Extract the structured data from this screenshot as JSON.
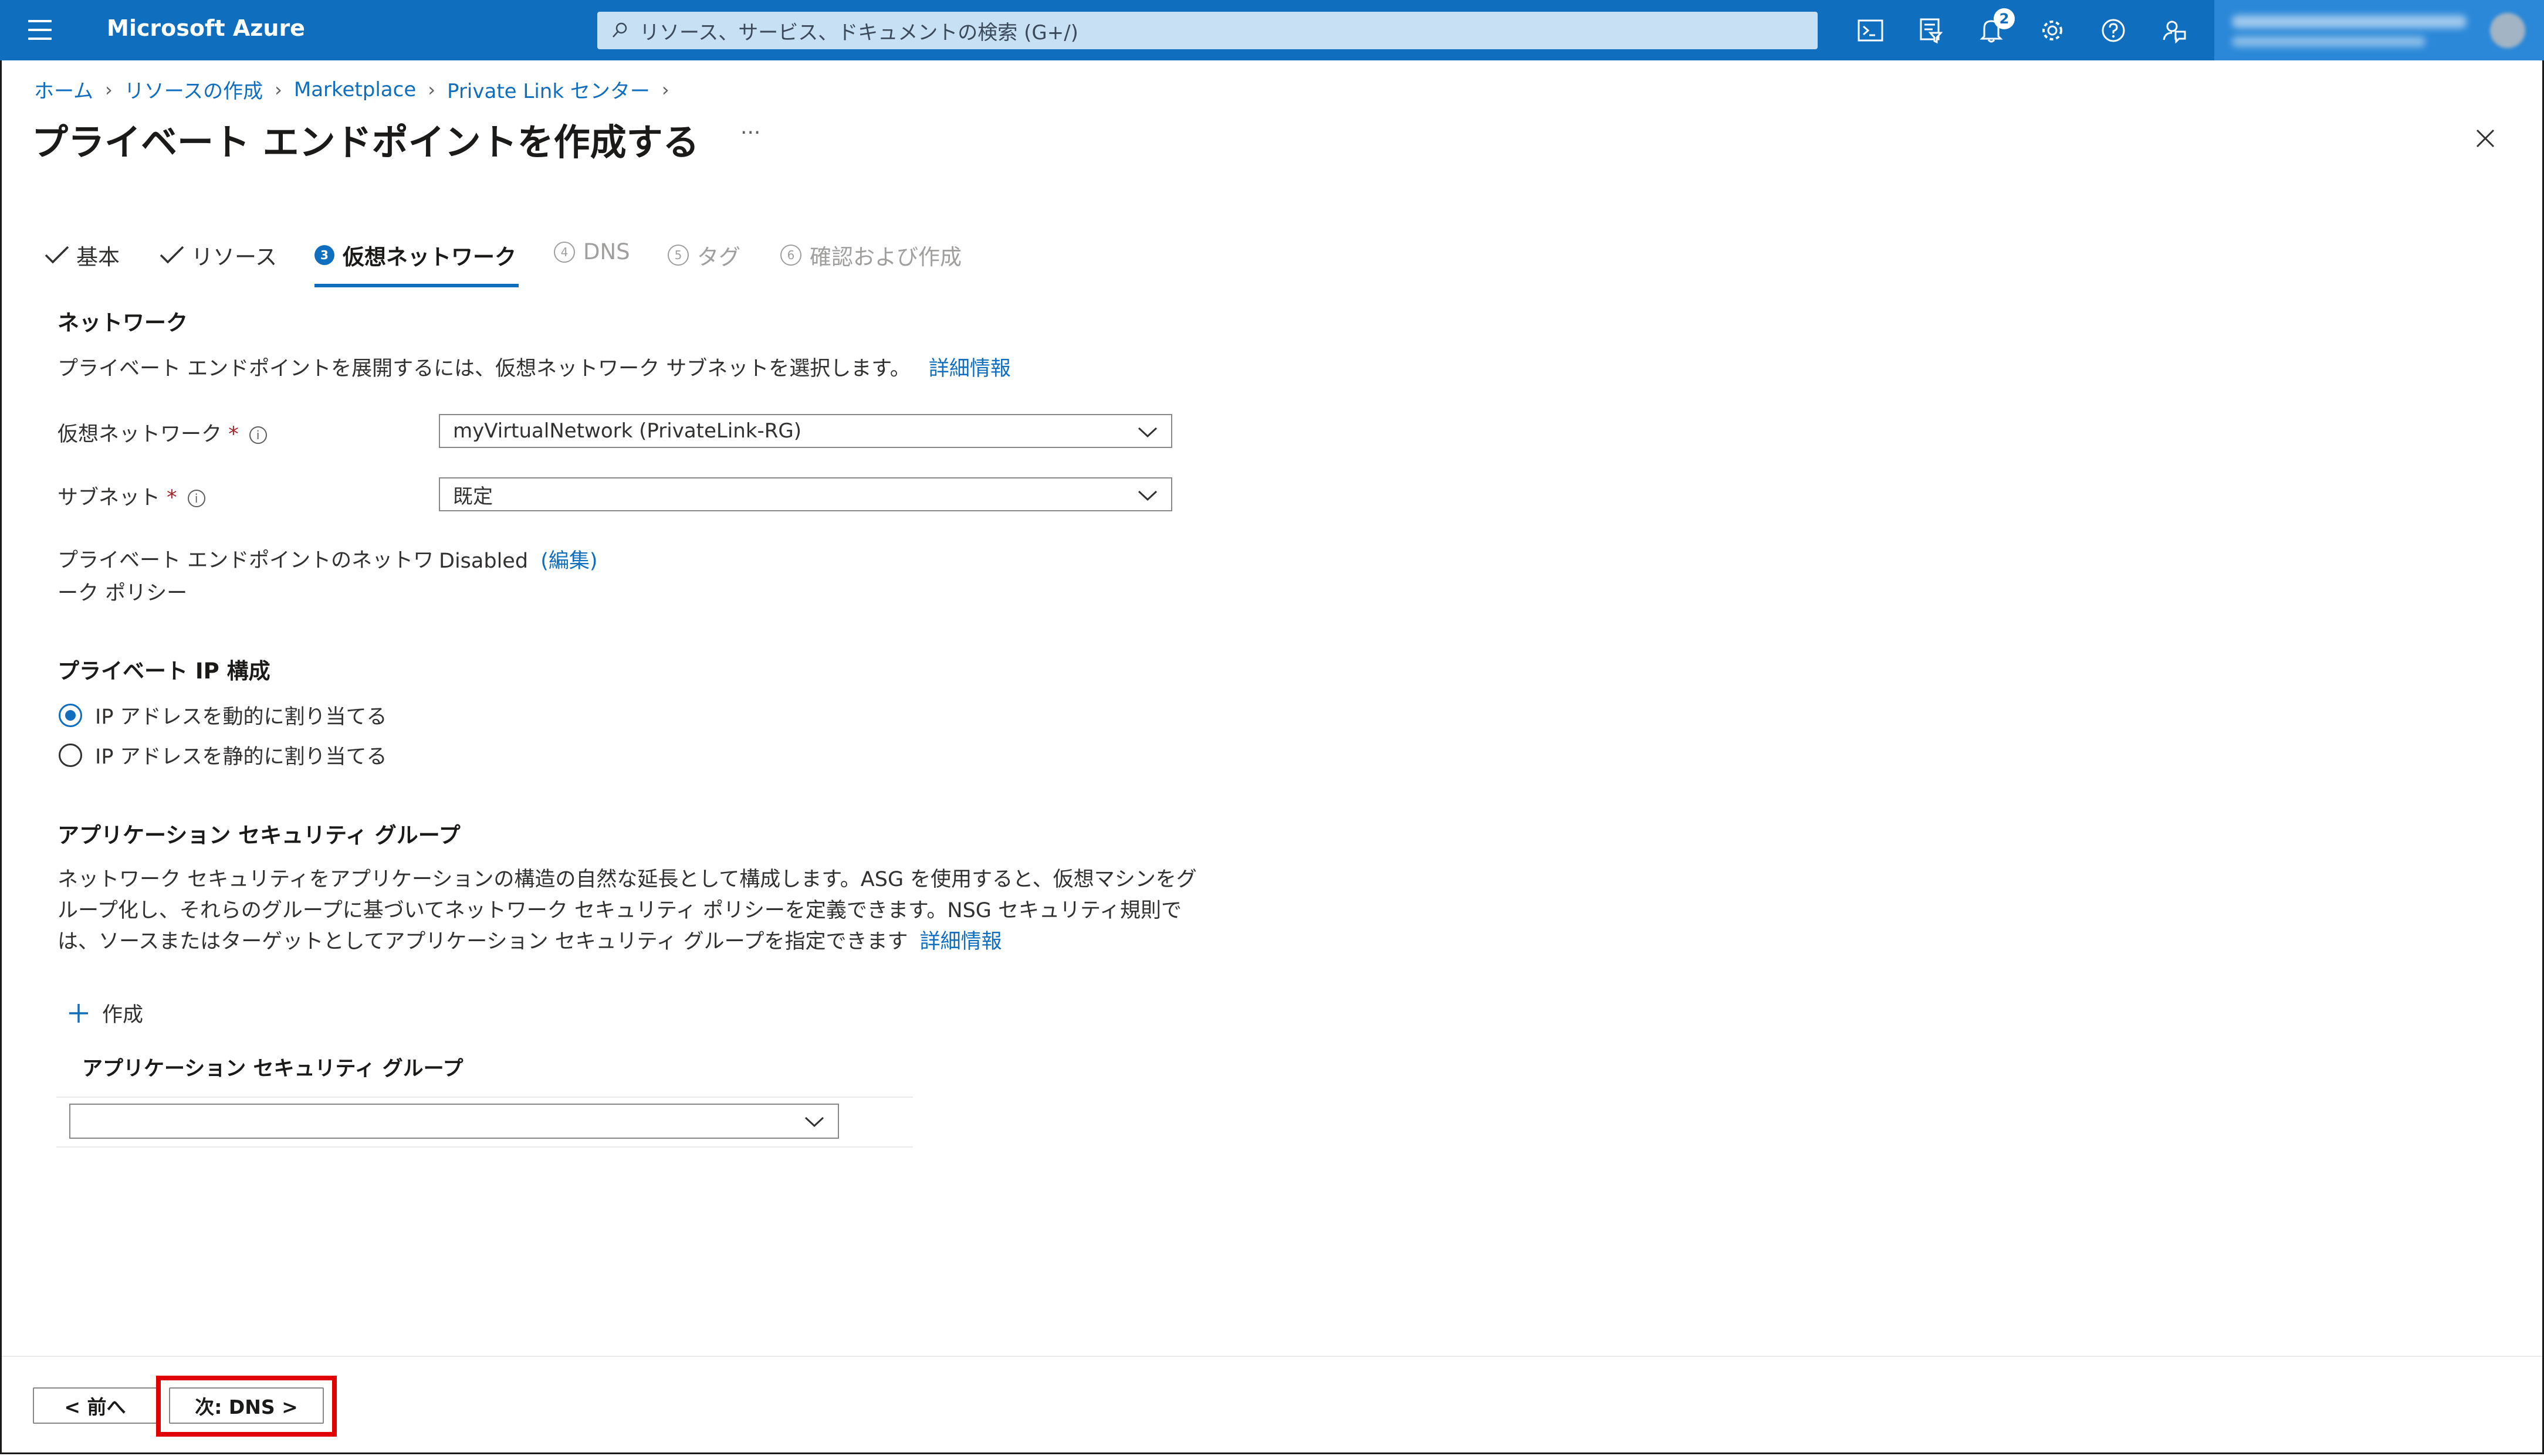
{
  "topbar": {
    "brand": "Microsoft Azure",
    "search_placeholder": "リソース、サービス、ドキュメントの検索 (G+/)",
    "notification_count": "2",
    "icons": [
      "cloud-shell-icon",
      "directory-filter-icon",
      "bell-icon",
      "gear-icon",
      "help-icon",
      "feedback-icon"
    ]
  },
  "breadcrumb": [
    "ホーム",
    "リソースの作成",
    "Marketplace",
    "Private Link センター"
  ],
  "page_title": "プライベート エンドポイントを作成する",
  "tabs": [
    {
      "label": "基本",
      "state": "done"
    },
    {
      "label": "リソース",
      "state": "done"
    },
    {
      "num": "3",
      "label": "仮想ネットワーク",
      "state": "active"
    },
    {
      "num": "4",
      "label": "DNS",
      "state": "disabled"
    },
    {
      "num": "5",
      "label": "タグ",
      "state": "disabled"
    },
    {
      "num": "6",
      "label": "確認および作成",
      "state": "disabled"
    }
  ],
  "network": {
    "heading": "ネットワーク",
    "description": "プライベート エンドポイントを展開するには、仮想ネットワーク サブネットを選択します。",
    "learn_more": "詳細情報",
    "vnet_label": "仮想ネットワーク",
    "vnet_value": "myVirtualNetwork (PrivateLink-RG)",
    "subnet_label": "サブネット",
    "subnet_value": "既定",
    "policy_label_line1": "プライベート エンドポイントのネットワ",
    "policy_label_line2": "ーク ポリシー",
    "policy_value": "Disabled",
    "policy_edit": "(編集)"
  },
  "ip_config": {
    "heading": "プライベート IP 構成",
    "option_dynamic": "IP アドレスを動的に割り当てる",
    "option_static": "IP アドレスを静的に割り当てる",
    "selected": "dynamic"
  },
  "asg": {
    "heading": "アプリケーション セキュリティ グループ",
    "desc_line1": "ネットワーク セキュリティをアプリケーションの構造の自然な延長として構成します。ASG を使用すると、仮想マシンをグ",
    "desc_line2": "ループ化し、それらのグループに基づいてネットワーク セキュリティ ポリシーを定義できます。NSG セキュリティ規則で",
    "desc_line3": "は、ソースまたはターゲットとしてアプリケーション セキュリティ グループを指定できます",
    "learn_more": "詳細情報",
    "create_label": "作成",
    "column_header": "アプリケーション セキュリティ グループ",
    "select_value": ""
  },
  "footer": {
    "prev_label": "< 前へ",
    "next_label": "次: DNS >"
  },
  "colors": {
    "topbar": "#106ebe",
    "accent": "#106ebe",
    "highlight": "#e00000"
  }
}
